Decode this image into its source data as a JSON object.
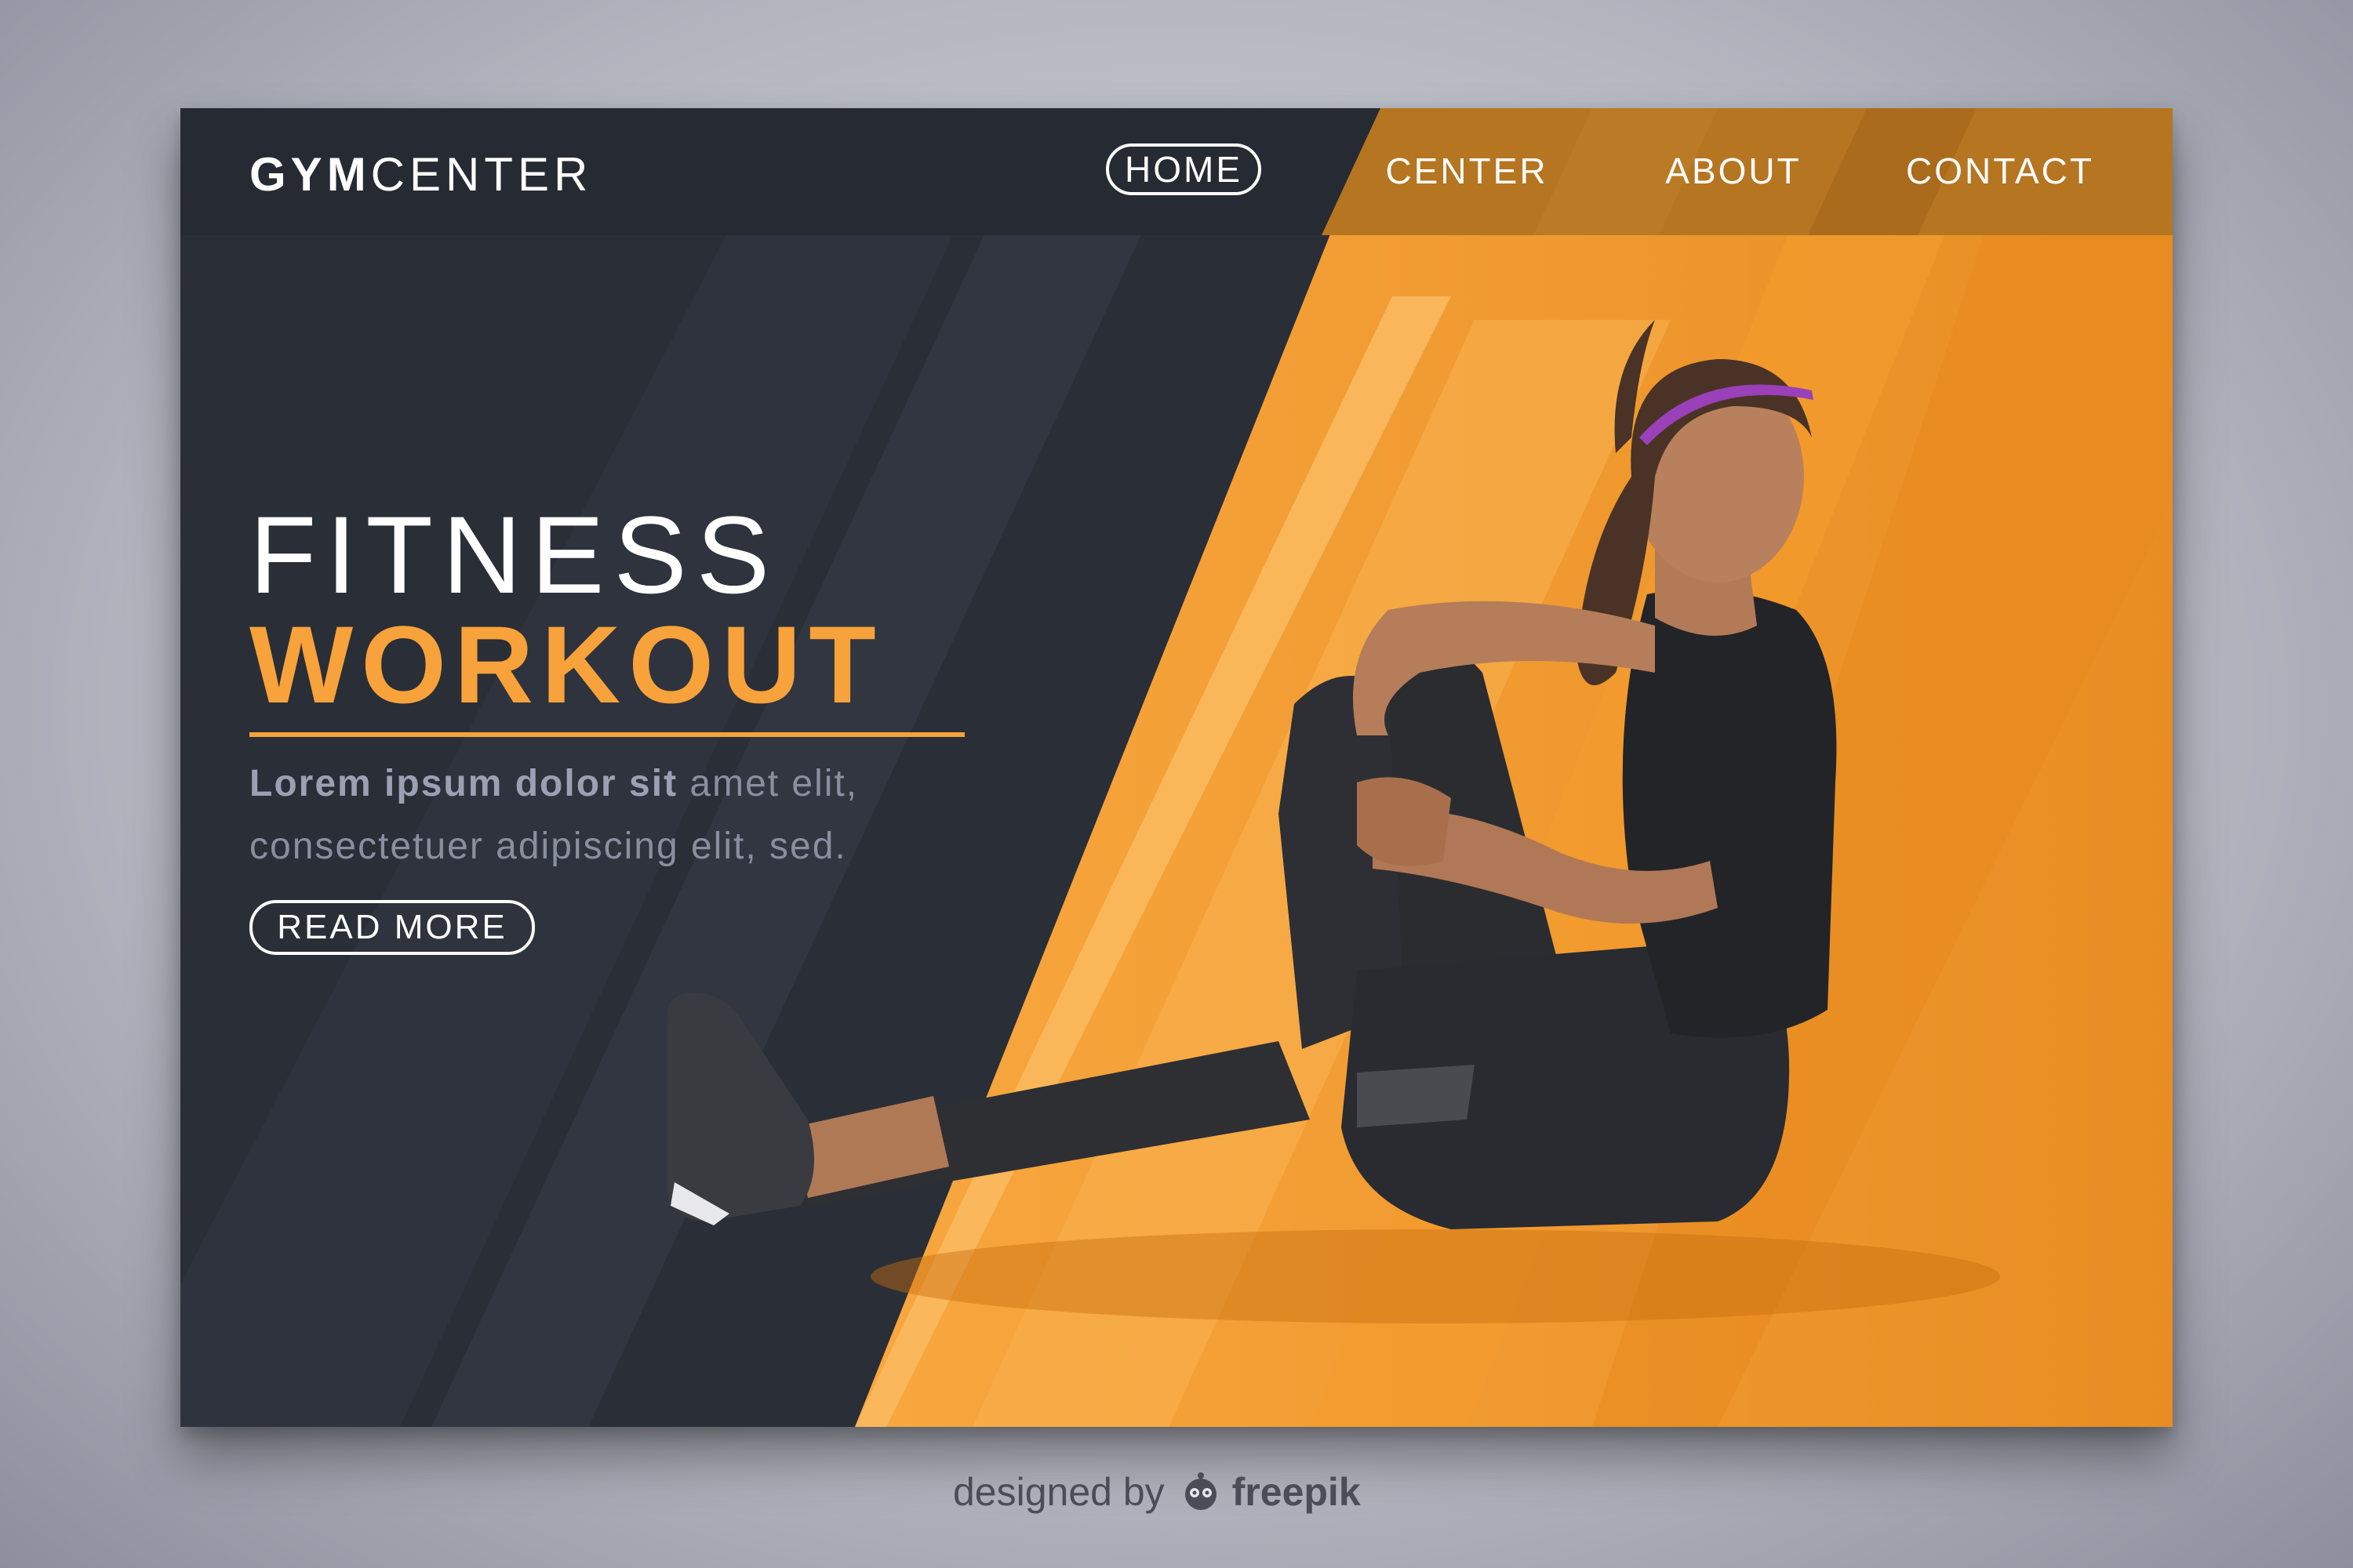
{
  "brand": {
    "logo_bold": "GYM",
    "logo_light": "CENTER"
  },
  "nav": {
    "home": "HOME",
    "center": "CENTER",
    "about": "ABOUT",
    "contact": "CONTACT"
  },
  "hero": {
    "title_line1": "FITNESS",
    "title_line2": "WORKOUT",
    "desc_bold": "Lorem ipsum dolor sit",
    "desc_rest_line1": " amet elit,",
    "desc_line2": "consectetuer adipiscing elit, sed.",
    "cta_label": "READ MORE"
  },
  "image": {
    "subject": "woman-stretching-seated"
  },
  "footer": {
    "credit_prefix": "designed by",
    "credit_brand": "freepik"
  },
  "colors": {
    "dark_panel": "#2a2e37",
    "accent_orange": "#f7a23a",
    "text_white": "#ffffff",
    "muted_text": "#8a8f9f"
  }
}
